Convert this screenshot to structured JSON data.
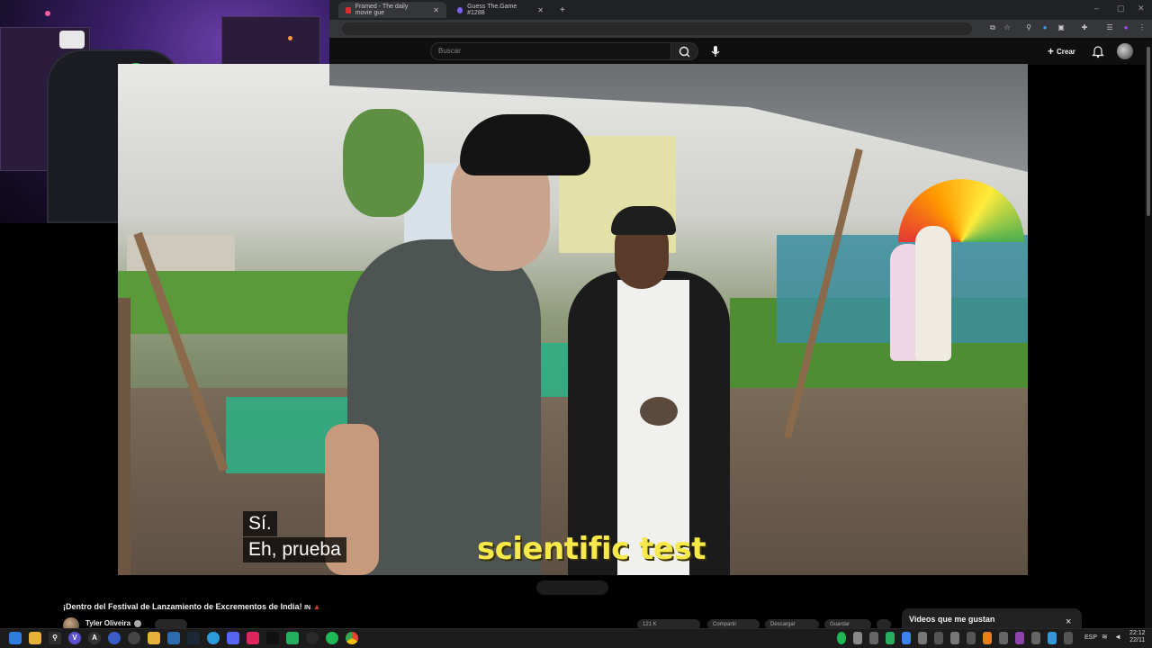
{
  "browser": {
    "tabs": [
      {
        "label": "Framed - The daily movie gue"
      },
      {
        "label": "Guess The.Game #1288"
      }
    ],
    "new_tab": "+",
    "min": "–",
    "close": "✕"
  },
  "youtube": {
    "search_placeholder": "Buscar",
    "create_label": "Crear"
  },
  "video": {
    "subtitle_line1": "Sí.",
    "subtitle_line2": "Eh, prueba",
    "burned_caption": "scientific test"
  },
  "info": {
    "title": "¡Dentro del Festival de Lanzamiento de Excrementos de India!",
    "channel": "Tyler Oliveira",
    "pill_actions": [
      "121 K",
      "Compartir",
      "Descargar",
      "Guardar"
    ]
  },
  "liked_panel": {
    "title": "Videos que me gustan",
    "close": "×"
  },
  "taskbar": {
    "apps": [
      "win",
      "search",
      "v",
      "browser",
      "ak",
      "folder",
      "teams",
      "steam",
      "store",
      "discord",
      "music",
      "tiktok",
      "game",
      "obs",
      "chrome-rec",
      "spotify",
      "chrome"
    ],
    "lang": "ESP",
    "time": "22:12",
    "date": "22/11"
  },
  "colors": {
    "accent_yellow": "#f7e94a",
    "yt_bg": "#0f0f0f",
    "razer_green": "#2ee35a"
  }
}
